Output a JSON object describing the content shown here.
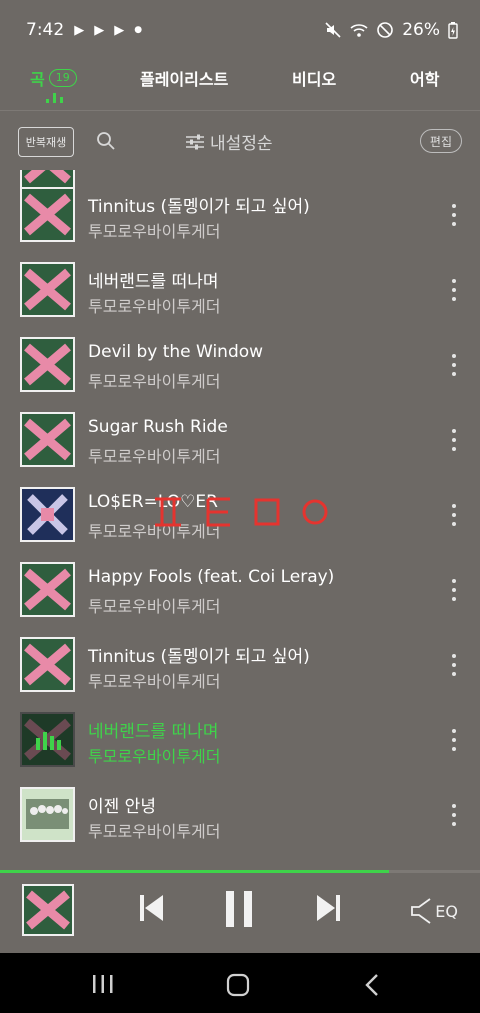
{
  "status_bar": {
    "time": "7:42",
    "battery": "26%"
  },
  "tabs": {
    "song_label": "곡",
    "song_count": "19",
    "playlist_label": "플레이리스트",
    "video_label": "비디오",
    "language_label": "어학"
  },
  "toolbar": {
    "repeat_label": "반복재생",
    "sort_label": "내설정순",
    "edit_label": "편집"
  },
  "songs": [
    {
      "title": "Tinnitus (돌멩이가 되고 싶어)",
      "artist": "투모로우바이투게더",
      "art": "pink"
    },
    {
      "title": "네버랜드를 떠나며",
      "artist": "투모로우바이투게더",
      "art": "pink"
    },
    {
      "title": "Devil by the Window",
      "artist": "투모로우바이투게더",
      "art": "pink"
    },
    {
      "title": "Sugar Rush Ride",
      "artist": "투모로우바이투게더",
      "art": "pink"
    },
    {
      "title": "LO$ER=LO♡ER",
      "artist": "투모로우바이투게더",
      "art": "blue"
    },
    {
      "title": "Happy Fools (feat. Coi Leray)",
      "artist": "투모로우바이투게더",
      "art": "pink"
    },
    {
      "title": "Tinnitus (돌멩이가 되고 싶어)",
      "artist": "투모로우바이투게더",
      "art": "pink"
    },
    {
      "title": "네버랜드를 떠나며",
      "artist": "투모로우바이투게더",
      "art": "playing"
    },
    {
      "title": "이젠 안녕",
      "artist": "투모로우바이투게더",
      "art": "photo"
    }
  ],
  "overlay_text": "ㅍㅌㅁㅇ",
  "player": {
    "progress": 0.81,
    "eq_label": "EQ"
  },
  "colors": {
    "accent": "#3fd34a",
    "background": "#6d6965",
    "art_green": "#2f5e3e",
    "art_pink": "#e88aa8",
    "watermark": "#e5342f"
  },
  "icons": {
    "repeat": "repeat-icon",
    "search": "search-icon",
    "sort": "sort-sliders-icon",
    "more": "more-vertical-icon",
    "prev": "skip-previous-icon",
    "pause": "pause-icon",
    "next": "skip-next-icon",
    "eq": "speaker-eq-icon"
  }
}
